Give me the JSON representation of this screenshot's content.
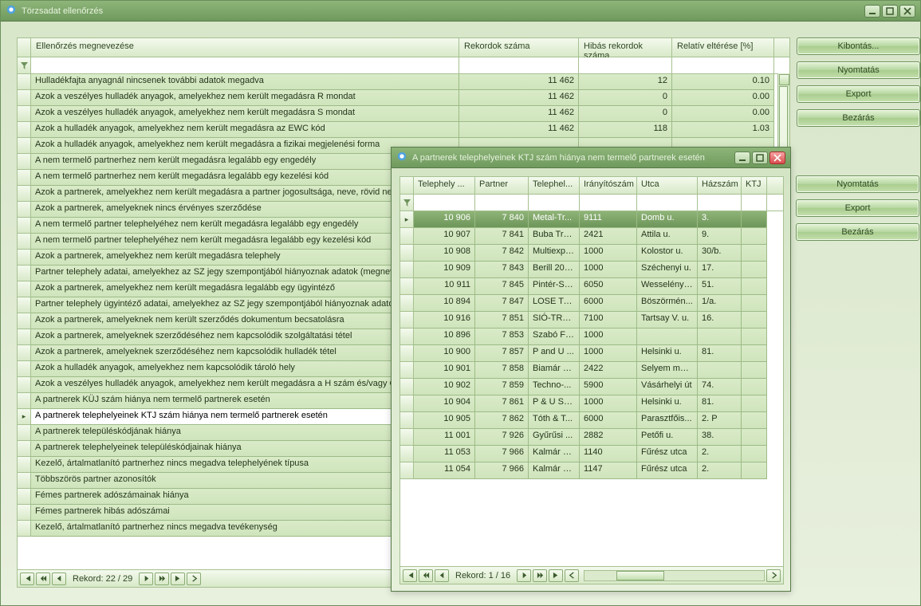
{
  "mainWindow": {
    "title": "Törzsadat ellenőrzés",
    "buttons": {
      "expand": "Kibontás...",
      "print": "Nyomtatás",
      "export": "Export",
      "close": "Bezárás"
    },
    "columns": {
      "name": "Ellenőrzés megnevezése",
      "records": "Rekordok száma",
      "bad": "Hibás rekordok száma",
      "pct": "Relatív eltérése [%]"
    },
    "rows": [
      {
        "name": "Hulladékfajta anyagnál nincsenek további adatok megadva",
        "rec": "11 462",
        "bad": "12",
        "pct": "0.10"
      },
      {
        "name": "Azok a veszélyes hulladék anyagok, amelyekhez nem került megadásra R mondat",
        "rec": "11 462",
        "bad": "0",
        "pct": "0.00"
      },
      {
        "name": "Azok a veszélyes hulladék anyagok, amelyekhez nem került megadásra S mondat",
        "rec": "11 462",
        "bad": "0",
        "pct": "0.00"
      },
      {
        "name": "Azok a hulladék anyagok, amelyekhez nem került megadásra az EWC kód",
        "rec": "11 462",
        "bad": "118",
        "pct": "1.03"
      },
      {
        "name": "Azok a hulladék anyagok, amelyekhez nem került megadásra a fizikai megjelenési forma"
      },
      {
        "name": "A nem termelő partnerhez nem került megadásra legalább egy engedély"
      },
      {
        "name": "A nem termelő partnerhez nem került megadásra legalább egy kezelési kód"
      },
      {
        "name": "Azok a partnerek, amelyekhez nem került megadásra a partner jogosultsága, neve, rövid neve"
      },
      {
        "name": "Azok a partnerek, amelyeknek nincs érvényes szerződése"
      },
      {
        "name": "A nem termelő partner telephelyéhez nem került megadásra legalább egy engedély"
      },
      {
        "name": "A nem termelő partner telephelyéhez nem került megadásra legalább egy kezelési kód"
      },
      {
        "name": "Azok a partnerek, amelyekhez nem került megadásra telephely"
      },
      {
        "name": "Partner telephely adatai, amelyekhez az SZ jegy szempontjából hiányoznak adatok (megnevezés, ..."
      },
      {
        "name": "Azok a partnerek, amelyekhez nem került megadásra legalább egy ügyintéző"
      },
      {
        "name": "Partner telephely ügyintéző adatai, amelyekhez az SZ jegy szempontjából hiányoznak adatok"
      },
      {
        "name": "Azok a partnerek, amelyeknek nem került szerződés dokumentum becsatolásra"
      },
      {
        "name": "Azok a partnerek, amelyeknek szerződéséhez nem kapcsolódik szolgáltatási tétel"
      },
      {
        "name": "Azok a partnerek, amelyeknek szerződéséhez nem kapcsolódik hulladék tétel"
      },
      {
        "name": "Azok a hulladék anyagok, amelyekhez nem kapcsolódik tároló hely"
      },
      {
        "name": "Azok a veszélyes hulladék anyagok, amelyekhez nem került megadásra a H szám és/vagy C szám"
      },
      {
        "name": "A partnerek KÜJ szám hiánya nem termelő partnerek esetén"
      },
      {
        "name": "A partnerek telephelyeinek KTJ szám hiánya nem termelő partnerek esetén",
        "sel": true
      },
      {
        "name": "A partnerek településkódjának hiánya"
      },
      {
        "name": "A partnerek telephelyeinek településkódjainak hiánya"
      },
      {
        "name": "Kezelő, ártalmatlanító partnerhez nincs megadva telephelyének típusa"
      },
      {
        "name": "Többszörös partner azonosítók"
      },
      {
        "name": "Fémes partnerek adószámainak hiánya"
      },
      {
        "name": "Fémes partnerek hibás adószámai"
      },
      {
        "name": "Kezelő, ártalmatlanító partnerhez nincs megadva tevékenység"
      }
    ],
    "nav": "Rekord: 22 / 29"
  },
  "childWindow": {
    "title": "A partnerek telephelyeinek KTJ szám hiánya nem termelő partnerek esetén",
    "buttons": {
      "print": "Nyomtatás",
      "export": "Export",
      "close": "Bezárás"
    },
    "columns": {
      "c1": "Telephely ...",
      "c2": "Partner",
      "c3": "Telephel...",
      "c4": "Irányítószám",
      "c5": "Utca",
      "c6": "Házszám",
      "c7": "KTJ"
    },
    "rows": [
      {
        "c1": "10 906",
        "c2": "7 840",
        "c3": "Metal-Tr...",
        "c4": "9111",
        "c5": "Domb u.",
        "c6": "3.",
        "sel": true
      },
      {
        "c1": "10 907",
        "c2": "7 841",
        "c3": "Buba Tra...",
        "c4": "2421",
        "c5": "Attila u.",
        "c6": "9."
      },
      {
        "c1": "10 908",
        "c2": "7 842",
        "c3": "Multiexpr...",
        "c4": "1000",
        "c5": "Kolostor u.",
        "c6": "30/b."
      },
      {
        "c1": "10 909",
        "c2": "7 843",
        "c3": "Berill 200...",
        "c4": "1000",
        "c5": "Széchenyi u.",
        "c6": "17."
      },
      {
        "c1": "10 911",
        "c2": "7 845",
        "c3": "Pintér-Sp...",
        "c4": "6050",
        "c5": "Wesselényi ...",
        "c6": "51."
      },
      {
        "c1": "10 894",
        "c2": "7 847",
        "c3": "LOSE Tra...",
        "c4": "6000",
        "c5": "Böszörmén...",
        "c6": "1/a."
      },
      {
        "c1": "10 916",
        "c2": "7 851",
        "c3": "SIÓ-TRA...",
        "c4": "7100",
        "c5": "Tartsay V. u.",
        "c6": "16."
      },
      {
        "c1": "10 896",
        "c2": "7 853",
        "c3": "Szabó Fe...",
        "c4": "1000",
        "c5": "",
        "c6": ""
      },
      {
        "c1": "10 900",
        "c2": "7 857",
        "c3": "P and U ...",
        "c4": "1000",
        "c5": "Helsinki u.",
        "c6": "81."
      },
      {
        "c1": "10 901",
        "c2": "7 858",
        "c3": "Biamár K...",
        "c4": "2422",
        "c5": "Selyem major",
        "c6": ""
      },
      {
        "c1": "10 902",
        "c2": "7 859",
        "c3": "Techno-...",
        "c4": "5900",
        "c5": "Vásárhelyi út",
        "c6": "74."
      },
      {
        "c1": "10 904",
        "c2": "7 861",
        "c3": "P & U Sp...",
        "c4": "1000",
        "c5": "Helsinki u.",
        "c6": "81."
      },
      {
        "c1": "10 905",
        "c2": "7 862",
        "c3": "Tóth & T...",
        "c4": "6000",
        "c5": "Parasztfőis...",
        "c6": "2. P"
      },
      {
        "c1": "11 001",
        "c2": "7 926",
        "c3": "Gyűrűsi ...",
        "c4": "2882",
        "c5": "Petőfi u.",
        "c6": "38."
      },
      {
        "c1": "11 053",
        "c2": "7 966",
        "c3": "Kalmár é...",
        "c4": "1140",
        "c5": "Fűrész utca",
        "c6": "2."
      },
      {
        "c1": "11 054",
        "c2": "7 966",
        "c3": "Kalmár é...",
        "c4": "1147",
        "c5": "Fűrész utca",
        "c6": "2."
      }
    ],
    "nav": "Rekord: 1 / 16"
  }
}
